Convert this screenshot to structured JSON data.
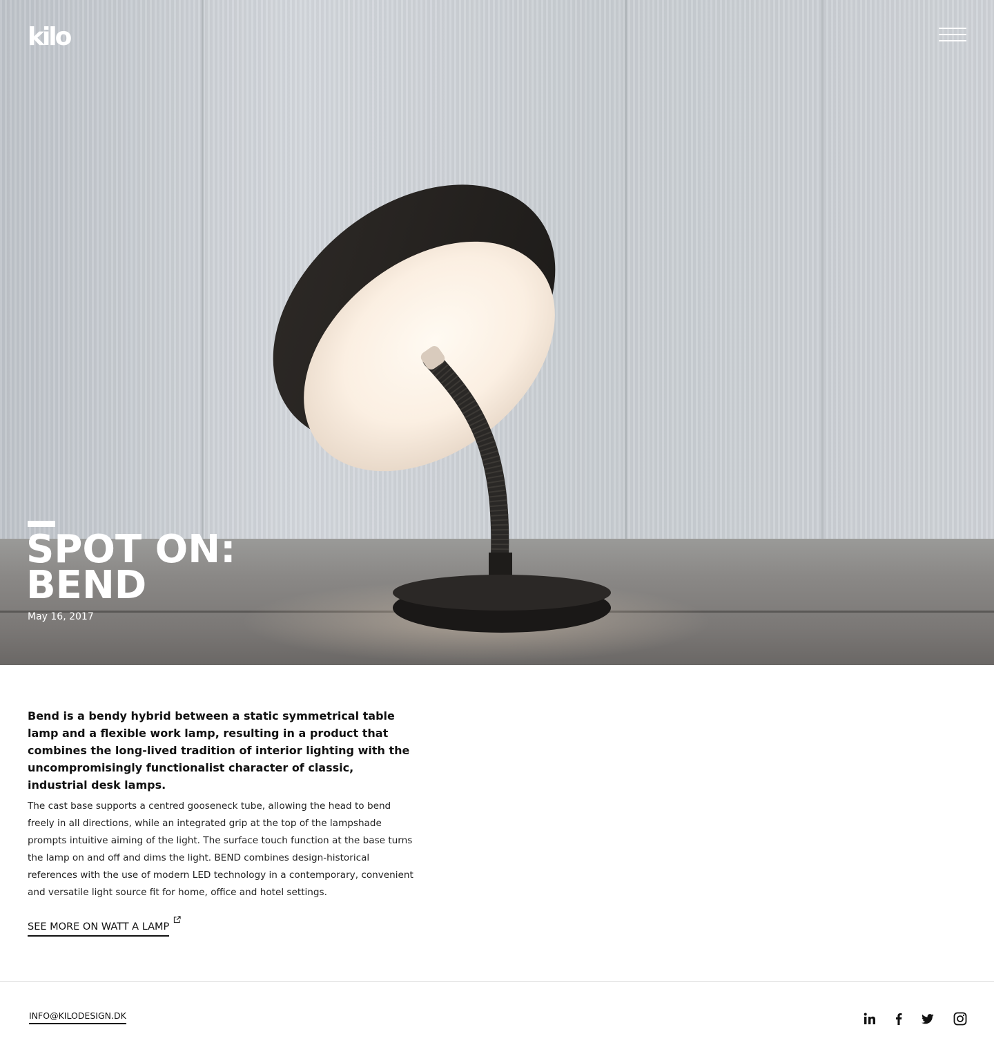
{
  "brand": {
    "logo_text": "kilo"
  },
  "header": {
    "menu_icon": "hamburger-menu-icon"
  },
  "hero": {
    "title_line1": "SPOT ON:",
    "title_line2": "BEND",
    "date": "May 16, 2017"
  },
  "article": {
    "intro": "Bend is a bendy hybrid between a static symmetrical table lamp and a flexible work lamp, resulting in a product that combines the long-lived tradition of interior lighting with the uncompromisingly functionalist character of classic, industrial desk lamps.",
    "body": "The cast base supports a centred gooseneck tube, allowing the head to bend freely in all directions, while an integrated grip at the top of the lampshade prompts intuitive aiming of the light. The surface touch function at the base turns the lamp on and off and dims the light. BEND combines design-historical references with the use of modern LED technology in a contemporary, convenient and versatile light source fit for home, office and hotel settings.",
    "link_label": "SEE MORE ON WATT A LAMP",
    "link_icon": "external-link-icon"
  },
  "footer": {
    "email": "INFO@KILODESIGN.DK",
    "social_icons": [
      "linkedin-icon",
      "facebook-icon",
      "twitter-icon",
      "instagram-icon"
    ]
  },
  "colors": {
    "text": "#111111",
    "background": "#ffffff",
    "hero_text": "#ffffff",
    "divider": "#d8d8d8"
  }
}
